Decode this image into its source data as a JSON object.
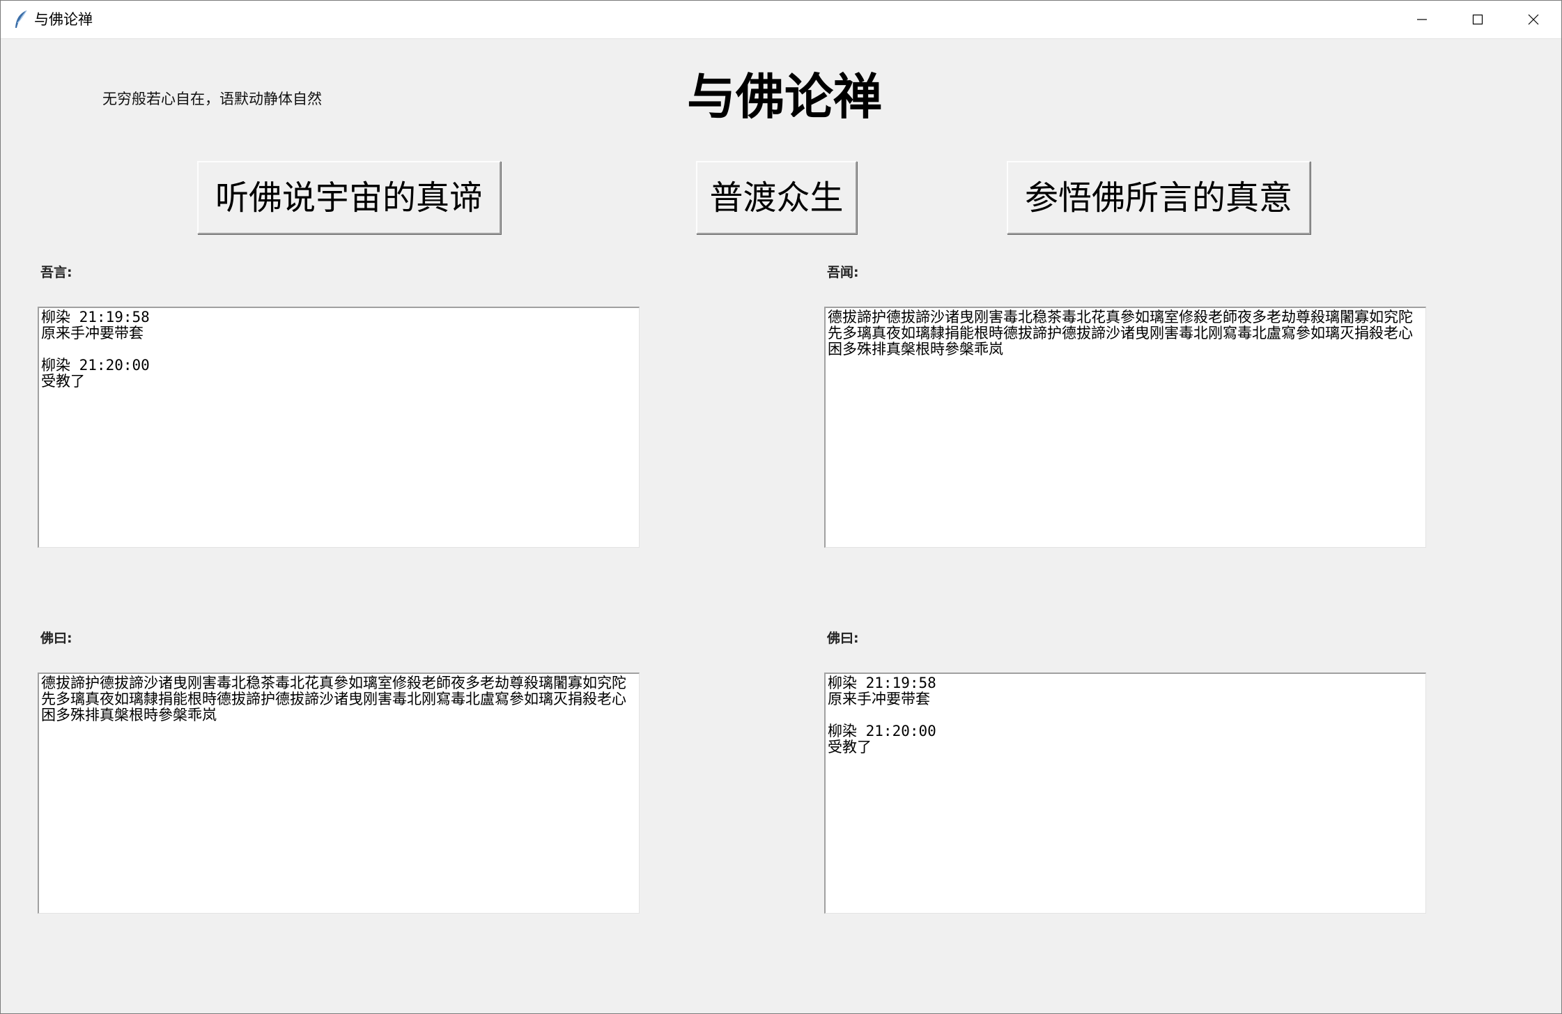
{
  "window": {
    "title": "与佛论禅",
    "icon": "feather-icon",
    "controls": [
      "minimize-icon",
      "maximize-icon",
      "close-icon"
    ]
  },
  "header": {
    "motto": "无穷般若心自在，语默动静体自然",
    "title": "与佛论禅"
  },
  "buttons": {
    "listen": "听佛说宇宙的真谛",
    "save": "普渡众生",
    "comprehend": "参悟佛所言的真意"
  },
  "panels": {
    "i_say": {
      "label": "吾言:",
      "text": "柳染 21:19:58\n原来手冲要带套\n\n柳染 21:20:00\n受教了"
    },
    "i_hear": {
      "label": "吾闻:",
      "text": "德拔諦护德拔諦沙诸曳刚害毒北稳茶毒北花真參如璃室修殺老師夜多老劫尊殺璃闍寡如究陀先多璃真夜如璃隸捐能根時德拔諦护德拔諦沙诸曳刚害毒北刚寫毒北盧寫參如璃灭捐殺老心困多殊排真槃根時參槃乖岚"
    },
    "buddha_says_left": {
      "label": "佛曰:",
      "text": "德拔諦护德拔諦沙诸曳刚害毒北稳茶毒北花真參如璃室修殺老師夜多老劫尊殺璃闍寡如究陀先多璃真夜如璃隸捐能根時德拔諦护德拔諦沙诸曳刚害毒北刚寫毒北盧寫參如璃灭捐殺老心困多殊排真槃根時參槃乖岚"
    },
    "buddha_says_right": {
      "label": "佛曰:",
      "text": "柳染 21:19:58\n原来手冲要带套\n\n柳染 21:20:00\n受教了"
    }
  }
}
